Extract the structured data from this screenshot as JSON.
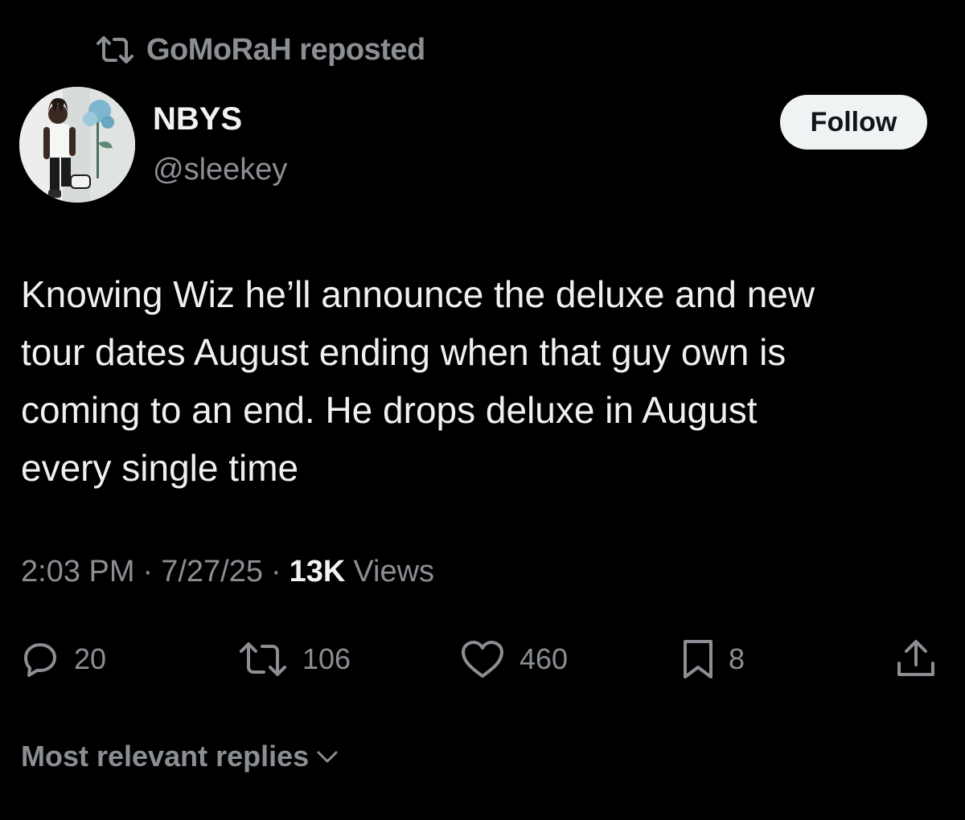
{
  "repost": {
    "icon": "repost-icon",
    "label": "GoMoRaH reposted"
  },
  "author": {
    "display_name": "NBYS",
    "handle": "@sleekey",
    "avatar": "avatar-photo"
  },
  "follow_label": "Follow",
  "tweet": {
    "text": "Knowing Wiz he’ll announce the deluxe and new\ntour dates August ending when that guy own is\ncoming to an end. He drops deluxe in August\nevery single time"
  },
  "meta": {
    "time": "2:03 PM",
    "date": "7/27/25",
    "views_count": "13K",
    "views_label": "Views"
  },
  "actions": {
    "replies": {
      "icon": "reply-icon",
      "count": "20"
    },
    "reposts": {
      "icon": "repost-icon",
      "count": "106"
    },
    "likes": {
      "icon": "heart-icon",
      "count": "460"
    },
    "bookmarks": {
      "icon": "bookmark-icon",
      "count": "8"
    },
    "share": {
      "icon": "share-icon"
    }
  },
  "replies_sort": {
    "label": "Most relevant replies",
    "icon": "chevron-down-icon"
  },
  "colors": {
    "background": "#000000",
    "text": "#e7e9ea",
    "secondary": "#8b8f94",
    "button_bg": "#eff3f4",
    "button_text": "#0f1419"
  }
}
